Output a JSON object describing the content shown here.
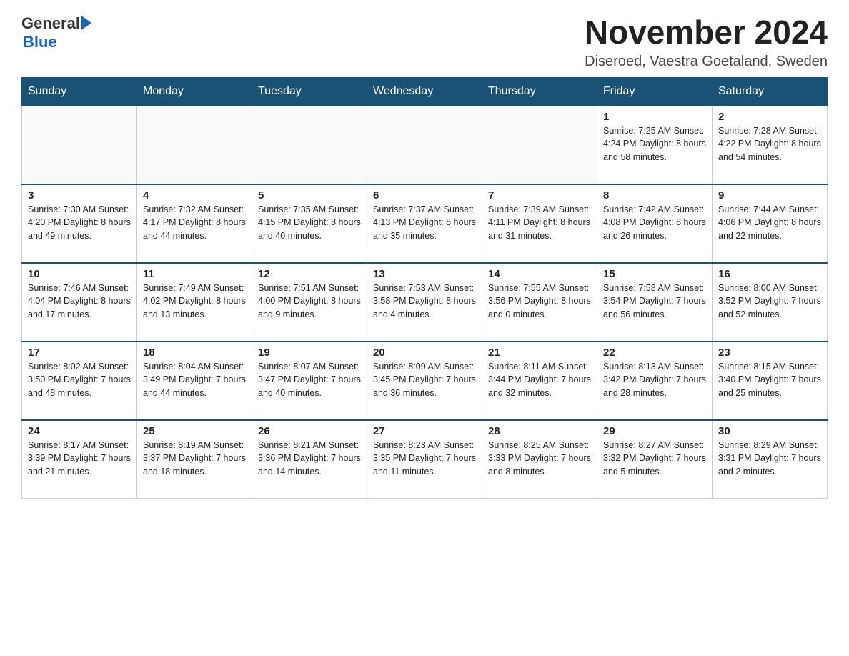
{
  "header": {
    "logo_general": "General",
    "logo_blue": "Blue",
    "month_title": "November 2024",
    "location": "Diseroed, Vaestra Goetaland, Sweden"
  },
  "weekdays": [
    "Sunday",
    "Monday",
    "Tuesday",
    "Wednesday",
    "Thursday",
    "Friday",
    "Saturday"
  ],
  "weeks": [
    [
      {
        "day": "",
        "info": ""
      },
      {
        "day": "",
        "info": ""
      },
      {
        "day": "",
        "info": ""
      },
      {
        "day": "",
        "info": ""
      },
      {
        "day": "",
        "info": ""
      },
      {
        "day": "1",
        "info": "Sunrise: 7:25 AM\nSunset: 4:24 PM\nDaylight: 8 hours and 58 minutes."
      },
      {
        "day": "2",
        "info": "Sunrise: 7:28 AM\nSunset: 4:22 PM\nDaylight: 8 hours and 54 minutes."
      }
    ],
    [
      {
        "day": "3",
        "info": "Sunrise: 7:30 AM\nSunset: 4:20 PM\nDaylight: 8 hours and 49 minutes."
      },
      {
        "day": "4",
        "info": "Sunrise: 7:32 AM\nSunset: 4:17 PM\nDaylight: 8 hours and 44 minutes."
      },
      {
        "day": "5",
        "info": "Sunrise: 7:35 AM\nSunset: 4:15 PM\nDaylight: 8 hours and 40 minutes."
      },
      {
        "day": "6",
        "info": "Sunrise: 7:37 AM\nSunset: 4:13 PM\nDaylight: 8 hours and 35 minutes."
      },
      {
        "day": "7",
        "info": "Sunrise: 7:39 AM\nSunset: 4:11 PM\nDaylight: 8 hours and 31 minutes."
      },
      {
        "day": "8",
        "info": "Sunrise: 7:42 AM\nSunset: 4:08 PM\nDaylight: 8 hours and 26 minutes."
      },
      {
        "day": "9",
        "info": "Sunrise: 7:44 AM\nSunset: 4:06 PM\nDaylight: 8 hours and 22 minutes."
      }
    ],
    [
      {
        "day": "10",
        "info": "Sunrise: 7:46 AM\nSunset: 4:04 PM\nDaylight: 8 hours and 17 minutes."
      },
      {
        "day": "11",
        "info": "Sunrise: 7:49 AM\nSunset: 4:02 PM\nDaylight: 8 hours and 13 minutes."
      },
      {
        "day": "12",
        "info": "Sunrise: 7:51 AM\nSunset: 4:00 PM\nDaylight: 8 hours and 9 minutes."
      },
      {
        "day": "13",
        "info": "Sunrise: 7:53 AM\nSunset: 3:58 PM\nDaylight: 8 hours and 4 minutes."
      },
      {
        "day": "14",
        "info": "Sunrise: 7:55 AM\nSunset: 3:56 PM\nDaylight: 8 hours and 0 minutes."
      },
      {
        "day": "15",
        "info": "Sunrise: 7:58 AM\nSunset: 3:54 PM\nDaylight: 7 hours and 56 minutes."
      },
      {
        "day": "16",
        "info": "Sunrise: 8:00 AM\nSunset: 3:52 PM\nDaylight: 7 hours and 52 minutes."
      }
    ],
    [
      {
        "day": "17",
        "info": "Sunrise: 8:02 AM\nSunset: 3:50 PM\nDaylight: 7 hours and 48 minutes."
      },
      {
        "day": "18",
        "info": "Sunrise: 8:04 AM\nSunset: 3:49 PM\nDaylight: 7 hours and 44 minutes."
      },
      {
        "day": "19",
        "info": "Sunrise: 8:07 AM\nSunset: 3:47 PM\nDaylight: 7 hours and 40 minutes."
      },
      {
        "day": "20",
        "info": "Sunrise: 8:09 AM\nSunset: 3:45 PM\nDaylight: 7 hours and 36 minutes."
      },
      {
        "day": "21",
        "info": "Sunrise: 8:11 AM\nSunset: 3:44 PM\nDaylight: 7 hours and 32 minutes."
      },
      {
        "day": "22",
        "info": "Sunrise: 8:13 AM\nSunset: 3:42 PM\nDaylight: 7 hours and 28 minutes."
      },
      {
        "day": "23",
        "info": "Sunrise: 8:15 AM\nSunset: 3:40 PM\nDaylight: 7 hours and 25 minutes."
      }
    ],
    [
      {
        "day": "24",
        "info": "Sunrise: 8:17 AM\nSunset: 3:39 PM\nDaylight: 7 hours and 21 minutes."
      },
      {
        "day": "25",
        "info": "Sunrise: 8:19 AM\nSunset: 3:37 PM\nDaylight: 7 hours and 18 minutes."
      },
      {
        "day": "26",
        "info": "Sunrise: 8:21 AM\nSunset: 3:36 PM\nDaylight: 7 hours and 14 minutes."
      },
      {
        "day": "27",
        "info": "Sunrise: 8:23 AM\nSunset: 3:35 PM\nDaylight: 7 hours and 11 minutes."
      },
      {
        "day": "28",
        "info": "Sunrise: 8:25 AM\nSunset: 3:33 PM\nDaylight: 7 hours and 8 minutes."
      },
      {
        "day": "29",
        "info": "Sunrise: 8:27 AM\nSunset: 3:32 PM\nDaylight: 7 hours and 5 minutes."
      },
      {
        "day": "30",
        "info": "Sunrise: 8:29 AM\nSunset: 3:31 PM\nDaylight: 7 hours and 2 minutes."
      }
    ]
  ]
}
